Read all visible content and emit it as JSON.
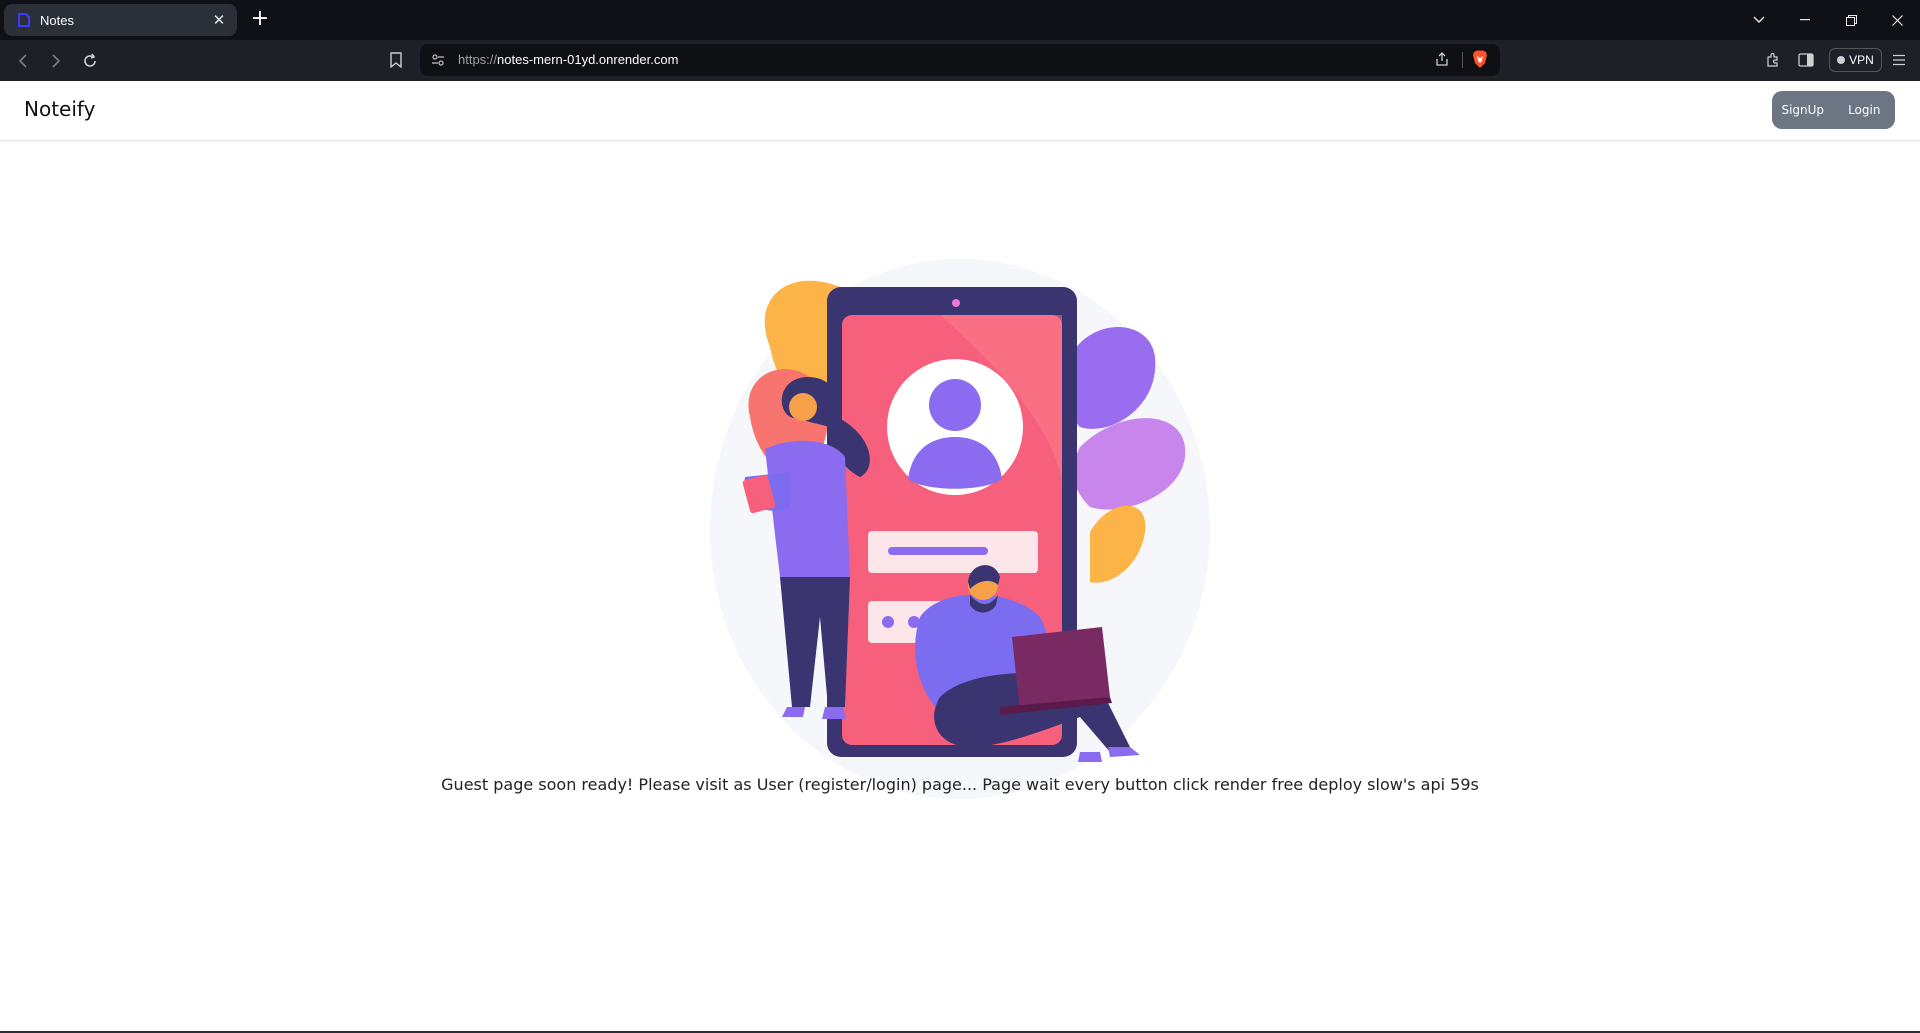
{
  "browser": {
    "tab": {
      "title": "Notes",
      "favicon": "notes-app-icon",
      "close_icon": "close-icon"
    },
    "new_tab_icon": "plus-icon",
    "window_controls": [
      "chevron-down-icon",
      "minimize-icon",
      "restore-icon",
      "close-icon"
    ],
    "address": {
      "scheme": "https://",
      "host": "notes-mern-01yd.onrender.com"
    },
    "vpn_label": "VPN"
  },
  "app": {
    "brand": "Noteify",
    "auth": {
      "signup_label": "SignUp",
      "login_label": "Login"
    },
    "hero_illustration": "login-illustration",
    "message": "Guest page soon ready! Please visit as User (register/login) page... Page wait every button click render free deploy slow's api 59s"
  },
  "colors": {
    "auth_bg": "#6c7584",
    "phone_screen": "#f6607d",
    "accent_purple": "#8b6cf0",
    "accent_orange": "#fcb448"
  }
}
